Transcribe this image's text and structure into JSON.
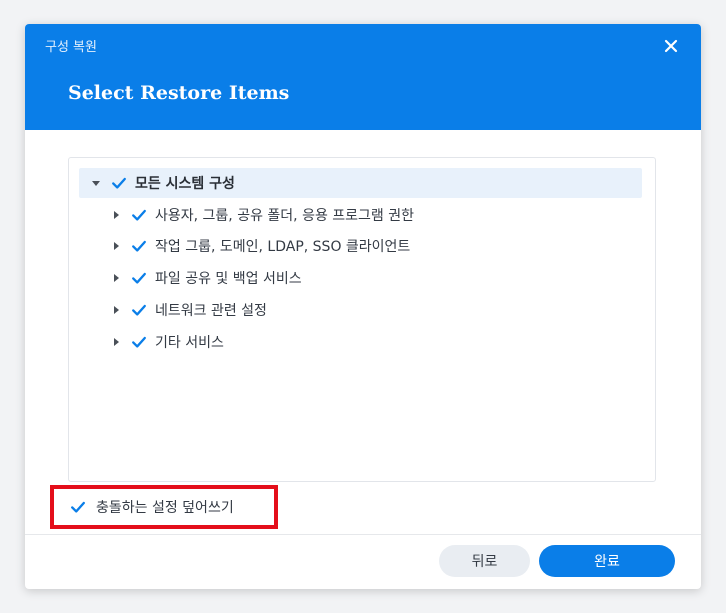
{
  "dialog": {
    "window_title": "구성 복원",
    "page_title": "Select Restore Items"
  },
  "tree": {
    "root": {
      "label": "모든 시스템 구성",
      "checked": true,
      "expanded": true
    },
    "items": [
      {
        "label": "사용자, 그룹, 공유 폴더, 응용 프로그램 권한",
        "checked": true,
        "expanded": false
      },
      {
        "label": "작업 그룹, 도메인, LDAP, SSO 클라이언트",
        "checked": true,
        "expanded": false
      },
      {
        "label": "파일 공유 및 백업 서비스",
        "checked": true,
        "expanded": false
      },
      {
        "label": "네트워크 관련 설정",
        "checked": true,
        "expanded": false
      },
      {
        "label": "기타 서비스",
        "checked": true,
        "expanded": false
      }
    ]
  },
  "options": {
    "overwrite_label": "충돌하는 설정 덮어쓰기",
    "overwrite_checked": true
  },
  "footer": {
    "back_label": "뒤로",
    "finish_label": "완료"
  },
  "colors": {
    "accent": "#0a7ee8",
    "highlight_border": "#e40e1a",
    "root_row_bg": "#e8f1fb"
  },
  "icons": {
    "close": "close-icon",
    "checkbox": "checkmark-icon",
    "expanded": "caret-down-icon",
    "collapsed": "caret-right-icon"
  }
}
